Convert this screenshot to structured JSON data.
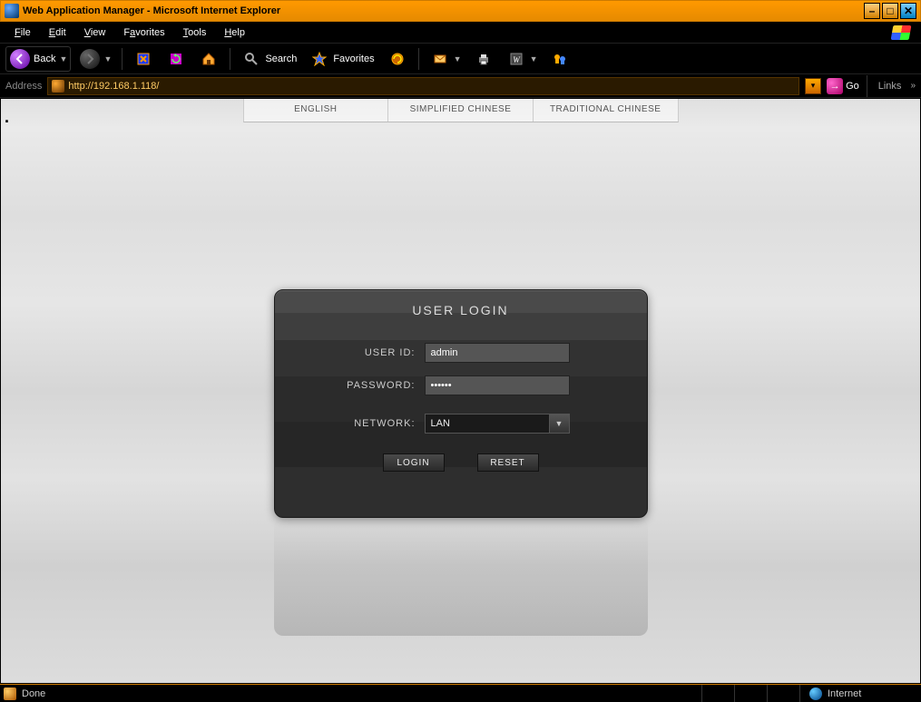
{
  "window": {
    "title": "Web Application Manager - Microsoft Internet Explorer"
  },
  "menubar": {
    "file": "File",
    "edit": "Edit",
    "view": "View",
    "favorites": "Favorites",
    "tools": "Tools",
    "help": "Help"
  },
  "toolbar": {
    "back": "Back",
    "search": "Search",
    "favorites": "Favorites"
  },
  "addressbar": {
    "label": "Address",
    "url": "http://192.168.1.118/",
    "go": "Go",
    "links": "Links"
  },
  "lang_tabs": {
    "english": "ENGLISH",
    "simplified": "SIMPLIFIED CHINESE",
    "traditional": "TRADITIONAL CHINESE"
  },
  "login": {
    "title": "USER LOGIN",
    "user_id_label": "USER ID:",
    "user_id_value": "admin",
    "password_label": "PASSWORD:",
    "password_value": "••••••",
    "network_label": "NETWORK:",
    "network_value": "LAN",
    "login_btn": "LOGIN",
    "reset_btn": "RESET"
  },
  "statusbar": {
    "done": "Done",
    "zone": "Internet"
  }
}
